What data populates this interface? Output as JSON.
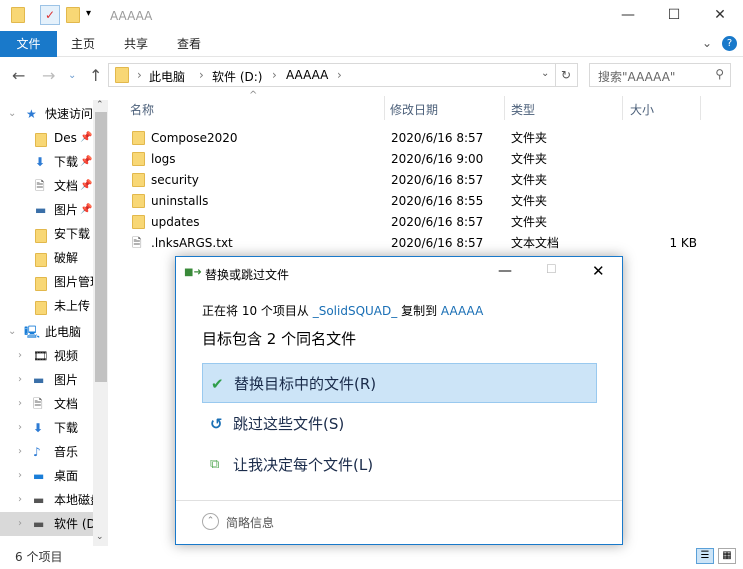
{
  "window": {
    "title": "AAAAA",
    "minimize": "—",
    "maximize": "☐",
    "close": "✕"
  },
  "ribbon": {
    "tabs": [
      "文件",
      "主页",
      "共享",
      "查看"
    ],
    "collapse": "⌄",
    "help": "?"
  },
  "address": {
    "crumbs": [
      "此电脑",
      "软件 (D:)",
      "AAAAA"
    ],
    "search_placeholder": "搜索\"AAAAA\""
  },
  "sidebar": {
    "quick_access": "快速访问",
    "quick": [
      {
        "label": "Des",
        "icon": "folder",
        "pinned": true
      },
      {
        "label": "下载",
        "icon": "download",
        "pinned": true
      },
      {
        "label": "文档",
        "icon": "document",
        "pinned": true
      },
      {
        "label": "图片",
        "icon": "picture",
        "pinned": true
      },
      {
        "label": "安下载",
        "icon": "folder"
      },
      {
        "label": "破解",
        "icon": "folder"
      },
      {
        "label": "图片管理",
        "icon": "folder"
      },
      {
        "label": "未上传",
        "icon": "folder"
      }
    ],
    "this_pc": "此电脑",
    "pc": [
      {
        "label": "视频",
        "icon": "video"
      },
      {
        "label": "图片",
        "icon": "picture"
      },
      {
        "label": "文档",
        "icon": "document"
      },
      {
        "label": "下载",
        "icon": "download"
      },
      {
        "label": "音乐",
        "icon": "music"
      },
      {
        "label": "桌面",
        "icon": "desktop"
      },
      {
        "label": "本地磁盘",
        "icon": "drive"
      },
      {
        "label": "软件 (D:)",
        "icon": "drive"
      }
    ]
  },
  "columns": [
    "名称",
    "修改日期",
    "类型",
    "大小"
  ],
  "files": [
    {
      "name": "Compose2020",
      "date": "2020/6/16 8:57",
      "type": "文件夹",
      "size": "",
      "icon": "folder"
    },
    {
      "name": "logs",
      "date": "2020/6/16 9:00",
      "type": "文件夹",
      "size": "",
      "icon": "folder"
    },
    {
      "name": "security",
      "date": "2020/6/16 8:57",
      "type": "文件夹",
      "size": "",
      "icon": "folder"
    },
    {
      "name": "uninstalls",
      "date": "2020/6/16 8:55",
      "type": "文件夹",
      "size": "",
      "icon": "folder"
    },
    {
      "name": "updates",
      "date": "2020/6/16 8:57",
      "type": "文件夹",
      "size": "",
      "icon": "folder"
    },
    {
      "name": ".lnksARGS.txt",
      "date": "2020/6/16 8:57",
      "type": "文本文档",
      "size": "1 KB",
      "icon": "text-file"
    }
  ],
  "status": {
    "count": "6 个项目"
  },
  "dialog": {
    "title": "替换或跳过文件",
    "progress_prefix": "正在将 10 个项目从 ",
    "source": "_SolidSQUAD_",
    "mid": " 复制到 ",
    "dest": "AAAAA",
    "heading": "目标包含 2 个同名文件",
    "options": [
      "替换目标中的文件(R)",
      "跳过这些文件(S)",
      "让我决定每个文件(L)"
    ],
    "details": "简略信息"
  },
  "colors": {
    "accent": "#1979ca",
    "selection": "#cce4f7",
    "link": "#1a6fb5"
  }
}
